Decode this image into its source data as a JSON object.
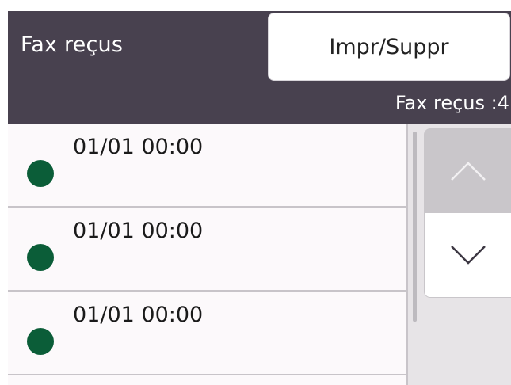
{
  "header": {
    "title": "Fax reçus",
    "action_label": "Impr/Suppr",
    "count_text": "Fax reçus :4"
  },
  "list": {
    "items": [
      {
        "date": "01/01 00:00",
        "status": "unread"
      },
      {
        "date": "01/01 00:00",
        "status": "unread"
      },
      {
        "date": "01/01 00:00",
        "status": "unread"
      }
    ]
  },
  "scroll": {
    "up_icon": "chevron-up-icon",
    "down_icon": "chevron-down-icon"
  },
  "colors": {
    "header_bg": "#48414f",
    "status_dot": "#0b5d38",
    "list_bg": "#fcf9fb",
    "scroll_up_bg": "#c9c6ca"
  }
}
